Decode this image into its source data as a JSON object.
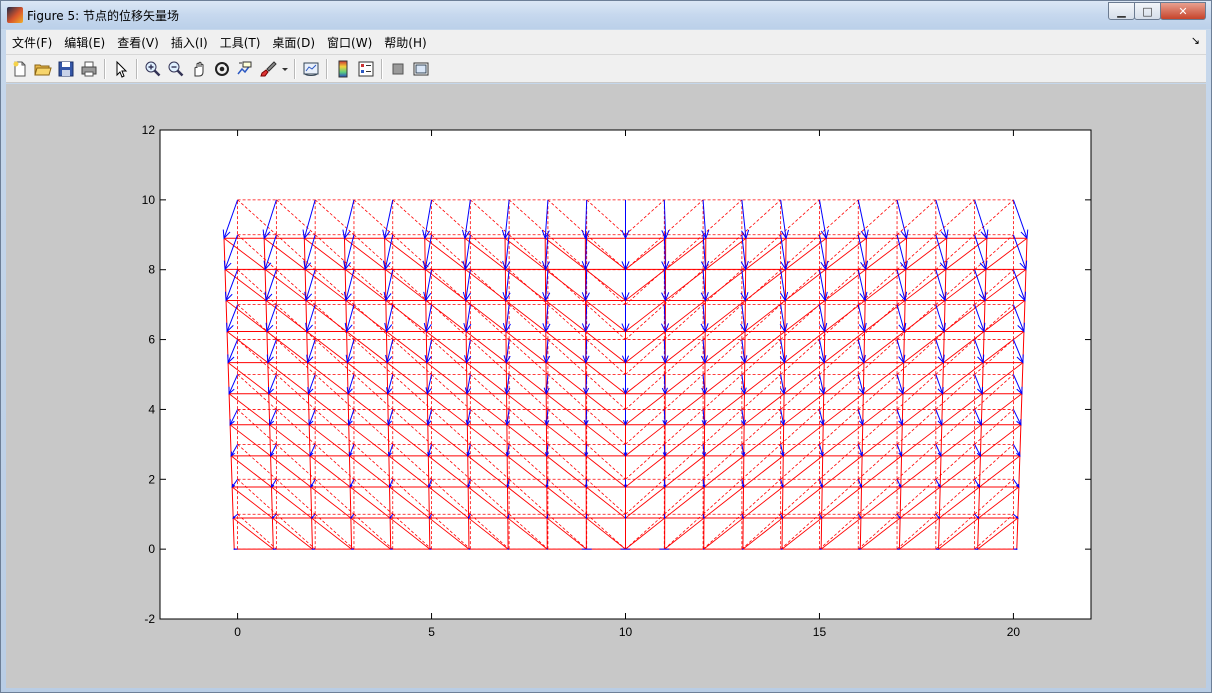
{
  "window": {
    "title": "Figure 5: 节点的位移矢量场",
    "minimize_label": "▁",
    "maximize_label": "□",
    "close_label": "✕"
  },
  "menu": {
    "items": [
      {
        "label": "文件(F)"
      },
      {
        "label": "编辑(E)"
      },
      {
        "label": "查看(V)"
      },
      {
        "label": "插入(I)"
      },
      {
        "label": "工具(T)"
      },
      {
        "label": "桌面(D)"
      },
      {
        "label": "窗口(W)"
      },
      {
        "label": "帮助(H)"
      }
    ],
    "overflow_icon": "dock-arrow-icon"
  },
  "toolbar": {
    "icons": [
      "new-figure-icon",
      "open-file-icon",
      "save-icon",
      "print-icon",
      "pointer-icon",
      "zoom-in-icon",
      "zoom-out-icon",
      "pan-icon",
      "rotate-3d-icon",
      "data-cursor-icon",
      "brush-icon",
      "brush-dropdown-icon",
      "link-plot-icon",
      "colorbar-icon",
      "legend-icon",
      "hide-plot-tools-icon",
      "show-plot-tools-icon"
    ]
  },
  "chart_data": {
    "type": "quiver",
    "title": "",
    "xlabel": "",
    "ylabel": "",
    "xlim": [
      -2,
      22
    ],
    "ylim": [
      -2,
      12
    ],
    "x_ticks": [
      0,
      5,
      10,
      15,
      20
    ],
    "y_ticks": [
      -2,
      0,
      2,
      4,
      6,
      8,
      10,
      12
    ],
    "grid_x": [
      0,
      1,
      2,
      3,
      4,
      5,
      6,
      7,
      8,
      9,
      10,
      11,
      12,
      13,
      14,
      15,
      16,
      17,
      18,
      19,
      20
    ],
    "grid_y": [
      0,
      1,
      2,
      3,
      4,
      5,
      6,
      7,
      8,
      9,
      10
    ],
    "mesh_color": "#ff0000",
    "arrow_color": "#0000ff",
    "diagonal_direction": {
      "x_below_10": "down-right",
      "x_at_or_above_10": "up-right"
    },
    "arrow_displacement_scale": {
      "ux_max": 0.35,
      "uy_max": 1.1,
      "note_units": "data units"
    }
  }
}
